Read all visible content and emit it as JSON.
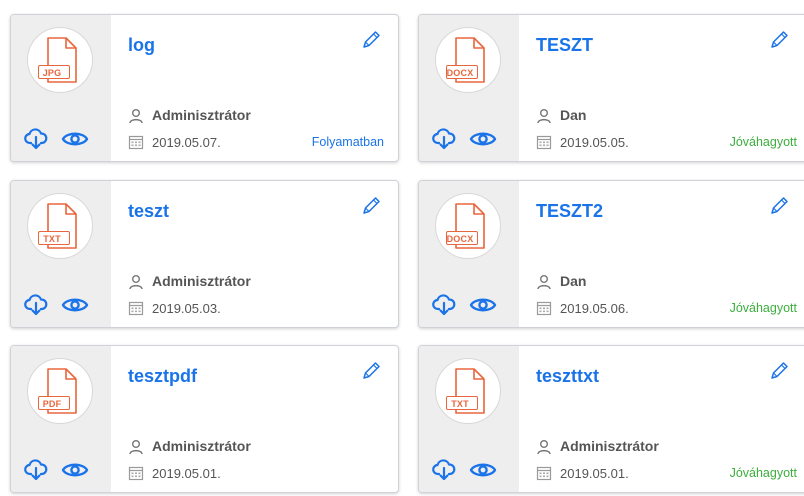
{
  "colors": {
    "accent": "#1a73e8",
    "file_icon": "#e8663d",
    "status_in_progress": "#1a73e8",
    "status_approved": "#3cae3c"
  },
  "cards": [
    {
      "title": "log",
      "file_type": "JPG",
      "author": "Adminisztrátor",
      "date": "2019.05.07.",
      "status": "Folyamatban",
      "status_kind": "inprogress"
    },
    {
      "title": "TESZT",
      "file_type": "DOCX",
      "author": "Dan",
      "date": "2019.05.05.",
      "status": "Jóváhagyott",
      "status_kind": "approved"
    },
    {
      "title": "teszt",
      "file_type": "TXT",
      "author": "Adminisztrátor",
      "date": "2019.05.03.",
      "status": "",
      "status_kind": "none"
    },
    {
      "title": "TESZT2",
      "file_type": "DOCX",
      "author": "Dan",
      "date": "2019.05.06.",
      "status": "Jóváhagyott",
      "status_kind": "approved"
    },
    {
      "title": "tesztpdf",
      "file_type": "PDF",
      "author": "Adminisztrátor",
      "date": "2019.05.01.",
      "status": "",
      "status_kind": "none"
    },
    {
      "title": "teszttxt",
      "file_type": "TXT",
      "author": "Adminisztrátor",
      "date": "2019.05.01.",
      "status": "Jóváhagyott",
      "status_kind": "approved"
    }
  ],
  "icons": {
    "file": "file-icon",
    "download": "cloud-download-icon",
    "view": "eye-icon",
    "edit": "pencil-icon",
    "user": "user-icon",
    "date": "calendar-icon"
  }
}
